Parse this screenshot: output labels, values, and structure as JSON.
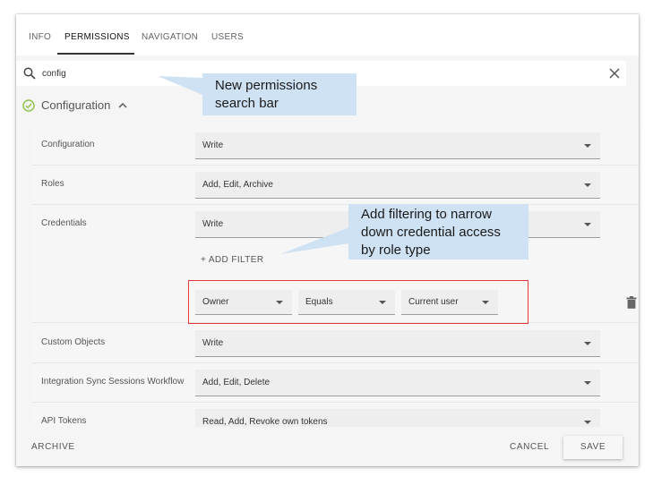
{
  "tabs": [
    {
      "label": "INFO"
    },
    {
      "label": "PERMISSIONS"
    },
    {
      "label": "NAVIGATION"
    },
    {
      "label": "USERS"
    }
  ],
  "search": {
    "value": "config"
  },
  "group": {
    "title": "Configuration"
  },
  "rows": [
    {
      "label": "Configuration",
      "value": "Write"
    },
    {
      "label": "Roles",
      "value": "Add, Edit, Archive"
    },
    {
      "label": "Credentials",
      "value": "Write"
    },
    {
      "label": "Custom Objects",
      "value": "Write"
    },
    {
      "label": "Integration Sync Sessions Workflow",
      "value": "Add, Edit, Delete"
    },
    {
      "label": "API Tokens",
      "value": "Read, Add, Revoke own tokens"
    }
  ],
  "add_filter": {
    "label": "+ ADD FILTER"
  },
  "filter": {
    "field": "Owner",
    "operator": "Equals",
    "value": "Current user"
  },
  "footer": {
    "archive": "ARCHIVE",
    "cancel": "CANCEL",
    "save": "SAVE"
  },
  "callouts": {
    "search": [
      "New permissions",
      "search bar"
    ],
    "filter": [
      "Add filtering to narrow",
      "down credential access",
      "by role type"
    ]
  },
  "colors": {
    "highlight_border": "#e53935",
    "callout_bg": "#cfe2f3",
    "check_green": "#8bc34a"
  },
  "icons": [
    "search-icon",
    "close-icon",
    "check-circle-icon",
    "chevron-up-icon",
    "chevron-down-icon",
    "trash-icon"
  ]
}
